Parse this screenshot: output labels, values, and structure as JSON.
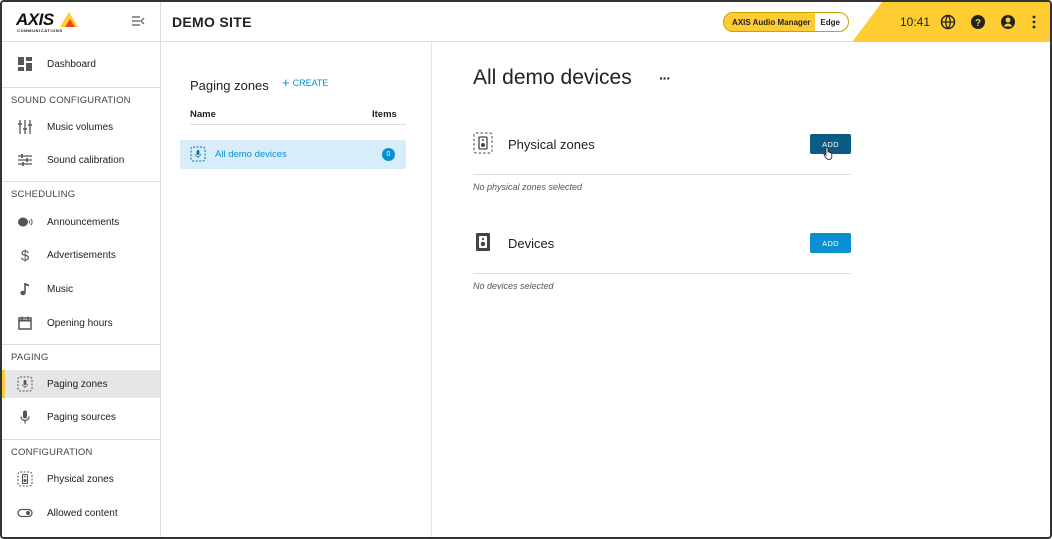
{
  "header": {
    "logo_text": "AXIS",
    "logo_subtext": "COMMUNICATIONS",
    "site_title": "DEMO SITE",
    "app_name": "AXIS Audio Manager",
    "app_edition": "Edge",
    "clock": "10:41",
    "icons": [
      "menu-collapse-icon",
      "globe-icon",
      "help-icon",
      "user-icon",
      "more-vertical-icon"
    ],
    "accent_color": "#ffcc33"
  },
  "sidebar": {
    "dashboard": "Dashboard",
    "sections": {
      "sound": "SOUND CONFIGURATION",
      "scheduling": "SCHEDULING",
      "paging": "PAGING",
      "configuration": "CONFIGURATION"
    },
    "items": {
      "music_volumes": "Music volumes",
      "sound_calibration": "Sound calibration",
      "announcements": "Announcements",
      "advertisements": "Advertisements",
      "music": "Music",
      "opening_hours": "Opening hours",
      "paging_zones": "Paging zones",
      "paging_sources": "Paging sources",
      "physical_zones": "Physical zones",
      "allowed_content": "Allowed content"
    },
    "active_item": "Paging zones"
  },
  "zones": {
    "title": "Paging zones",
    "create_label": "CREATE",
    "col_name": "Name",
    "col_items": "Items",
    "rows": [
      {
        "name": "All demo devices",
        "items": "0",
        "selected": true
      }
    ]
  },
  "detail": {
    "title": "All demo devices",
    "more_label": "···",
    "physical_zones": {
      "label": "Physical zones",
      "add_label": "ADD",
      "empty": "No physical zones selected"
    },
    "devices": {
      "label": "Devices",
      "add_label": "ADD",
      "empty": "No devices selected"
    },
    "primary_color": "#0b8fd3"
  }
}
